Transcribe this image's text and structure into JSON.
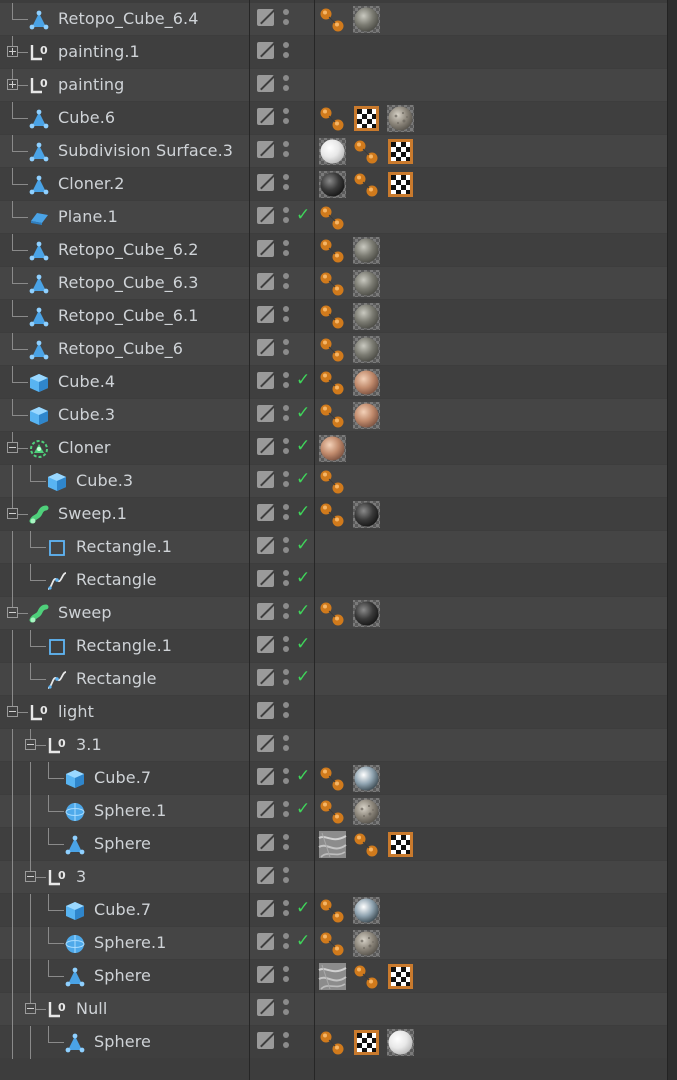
{
  "panel": "Object Manager",
  "rows": [
    {
      "name": "Retopo_Cube_6.4",
      "level": 0,
      "expander": "",
      "icon": "polygon-object-icon",
      "check": false,
      "tags": [
        "phong-tag-icon",
        "material-grey-icon"
      ]
    },
    {
      "name": "painting.1",
      "level": 0,
      "expander": "plus",
      "icon": "null-object-icon",
      "check": false,
      "tags": []
    },
    {
      "name": "painting",
      "level": 0,
      "expander": "plus",
      "icon": "null-object-icon",
      "check": false,
      "tags": []
    },
    {
      "name": "Cube.6",
      "level": 0,
      "expander": "",
      "icon": "polygon-object-icon",
      "check": false,
      "tags": [
        "phong-tag-icon",
        "checker-tag-icon",
        "material-rock-icon"
      ]
    },
    {
      "name": "Subdivision Surface.3",
      "level": 0,
      "expander": "",
      "icon": "polygon-object-icon",
      "check": false,
      "tags": [
        "material-white-icon",
        "phong-tag-icon",
        "checker-tag-icon"
      ]
    },
    {
      "name": "Cloner.2",
      "level": 0,
      "expander": "",
      "icon": "polygon-object-icon",
      "check": false,
      "tags": [
        "material-black-icon",
        "phong-tag-icon",
        "checker-tag-icon"
      ]
    },
    {
      "name": "Plane.1",
      "level": 0,
      "expander": "",
      "icon": "plane-icon",
      "check": true,
      "tags": [
        "phong-tag-icon"
      ]
    },
    {
      "name": "Retopo_Cube_6.2",
      "level": 0,
      "expander": "",
      "icon": "polygon-object-icon",
      "check": false,
      "tags": [
        "phong-tag-icon",
        "material-grey-icon"
      ]
    },
    {
      "name": "Retopo_Cube_6.3",
      "level": 0,
      "expander": "",
      "icon": "polygon-object-icon",
      "check": false,
      "tags": [
        "phong-tag-icon",
        "material-grey-icon"
      ]
    },
    {
      "name": "Retopo_Cube_6.1",
      "level": 0,
      "expander": "",
      "icon": "polygon-object-icon",
      "check": false,
      "tags": [
        "phong-tag-icon",
        "material-grey-icon"
      ]
    },
    {
      "name": "Retopo_Cube_6",
      "level": 0,
      "expander": "",
      "icon": "polygon-object-icon",
      "check": false,
      "tags": [
        "phong-tag-icon",
        "material-grey-icon"
      ]
    },
    {
      "name": "Cube.4",
      "level": 0,
      "expander": "",
      "icon": "cube-icon",
      "check": true,
      "tags": [
        "phong-tag-icon",
        "material-skin-icon"
      ]
    },
    {
      "name": "Cube.3",
      "level": 0,
      "expander": "",
      "icon": "cube-icon",
      "check": true,
      "tags": [
        "phong-tag-icon",
        "material-skin-icon"
      ]
    },
    {
      "name": "Cloner",
      "level": 0,
      "expander": "minus",
      "icon": "cloner-icon",
      "check": true,
      "tags": [
        "material-skin-icon"
      ]
    },
    {
      "name": "Cube.3",
      "level": 1,
      "expander": "",
      "icon": "cube-icon",
      "check": true,
      "tags": [
        "phong-tag-icon"
      ]
    },
    {
      "name": "Sweep.1",
      "level": 0,
      "expander": "minus",
      "icon": "sweep-icon",
      "check": true,
      "tags": [
        "phong-tag-icon",
        "material-black-icon"
      ]
    },
    {
      "name": "Rectangle.1",
      "level": 1,
      "expander": "",
      "icon": "rectangle-spline-icon",
      "check": true,
      "tags": []
    },
    {
      "name": "Rectangle",
      "level": 1,
      "expander": "",
      "icon": "spline-icon",
      "check": true,
      "tags": []
    },
    {
      "name": "Sweep",
      "level": 0,
      "expander": "minus",
      "icon": "sweep-icon",
      "check": true,
      "tags": [
        "phong-tag-icon",
        "material-black-icon"
      ]
    },
    {
      "name": "Rectangle.1",
      "level": 1,
      "expander": "",
      "icon": "rectangle-spline-icon",
      "check": true,
      "tags": []
    },
    {
      "name": "Rectangle",
      "level": 1,
      "expander": "",
      "icon": "spline-icon",
      "check": true,
      "tags": []
    },
    {
      "name": "light",
      "level": 0,
      "expander": "minus",
      "icon": "null-object-icon",
      "check": false,
      "tags": []
    },
    {
      "name": "3.1",
      "level": 1,
      "expander": "minus",
      "icon": "null-object-icon",
      "check": false,
      "tags": []
    },
    {
      "name": "Cube.7",
      "level": 2,
      "expander": "",
      "icon": "cube-icon",
      "check": true,
      "tags": [
        "phong-tag-icon",
        "material-chrome-icon"
      ]
    },
    {
      "name": "Sphere.1",
      "level": 2,
      "expander": "",
      "icon": "sphere-icon",
      "check": true,
      "tags": [
        "phong-tag-icon",
        "material-rock-icon"
      ]
    },
    {
      "name": "Sphere",
      "level": 2,
      "expander": "",
      "icon": "polygon-object-icon",
      "check": false,
      "tags": [
        "material-marble-icon",
        "phong-tag-icon",
        "checker-tag-icon"
      ]
    },
    {
      "name": "3",
      "level": 1,
      "expander": "minus",
      "icon": "null-object-icon",
      "check": false,
      "tags": []
    },
    {
      "name": "Cube.7",
      "level": 2,
      "expander": "",
      "icon": "cube-icon",
      "check": true,
      "tags": [
        "phong-tag-icon",
        "material-chrome-icon"
      ]
    },
    {
      "name": "Sphere.1",
      "level": 2,
      "expander": "",
      "icon": "sphere-icon",
      "check": true,
      "tags": [
        "phong-tag-icon",
        "material-rock-icon"
      ]
    },
    {
      "name": "Sphere",
      "level": 2,
      "expander": "",
      "icon": "polygon-object-icon",
      "check": false,
      "tags": [
        "material-marble-icon",
        "phong-tag-icon",
        "checker-tag-icon"
      ]
    },
    {
      "name": "Null",
      "level": 1,
      "expander": "minus",
      "icon": "null-object-icon",
      "check": false,
      "tags": []
    },
    {
      "name": "Sphere",
      "level": 2,
      "expander": "",
      "icon": "polygon-object-icon",
      "check": false,
      "tags": [
        "phong-tag-icon",
        "checker-tag-icon",
        "material-white-icon"
      ]
    }
  ]
}
